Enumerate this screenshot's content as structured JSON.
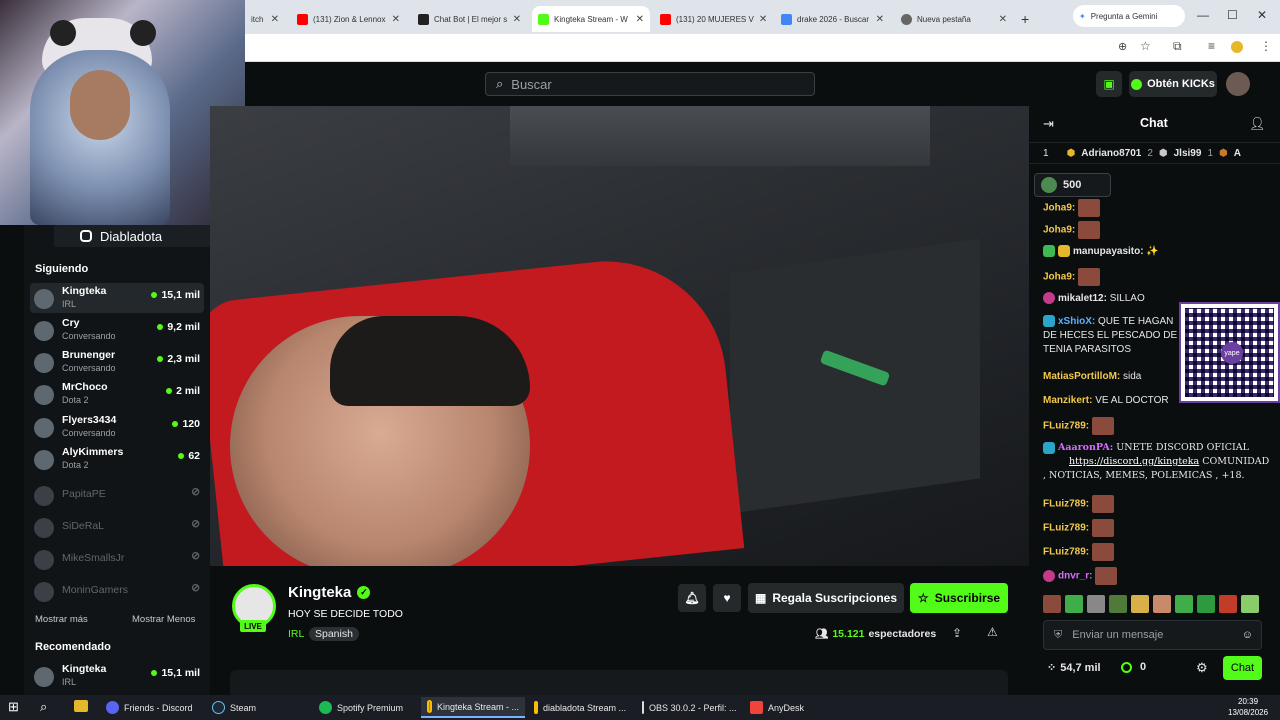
{
  "browser": {
    "tabs": [
      {
        "label": "itch",
        "color": "#9147ff"
      },
      {
        "label": "(131) Zion & Lennox",
        "color": "#ff0000"
      },
      {
        "label": "Chat Bot | El mejor s",
        "color": "#222222"
      },
      {
        "label": "Kingteka Stream - W",
        "color": "#53fc18"
      },
      {
        "label": "(131) 20 MUJERES V",
        "color": "#ff0000"
      },
      {
        "label": "drake 2026 - Buscar",
        "color": "#4285f4"
      },
      {
        "label": "Nueva pestaña",
        "color": "#666666"
      }
    ],
    "gemini_label": "Pregunta a Gemini"
  },
  "webcam": {
    "instagram_handle": "Diabladota"
  },
  "header": {
    "search_placeholder": "Buscar",
    "kicks_label": "Obtén KICKs"
  },
  "sidebar": {
    "following_title": "Siguiendo",
    "following": [
      {
        "name": "Kingteka",
        "category": "IRL",
        "viewers": "15,1 mil",
        "live": true,
        "selected": true
      },
      {
        "name": "Cry",
        "category": "Conversando",
        "viewers": "9,2 mil",
        "live": true
      },
      {
        "name": "Brunenger",
        "category": "Conversando",
        "viewers": "2,3 mil",
        "live": true
      },
      {
        "name": "MrChoco",
        "category": "Dota 2",
        "viewers": "2 mil",
        "live": true
      },
      {
        "name": "Flyers3434",
        "category": "Conversando",
        "viewers": "120",
        "live": true
      },
      {
        "name": "AlyKimmers",
        "category": "Dota 2",
        "viewers": "62",
        "live": true
      },
      {
        "name": "PapitaPE",
        "category": "",
        "viewers": "",
        "live": false
      },
      {
        "name": "SiDeRaL",
        "category": "",
        "viewers": "",
        "live": false
      },
      {
        "name": "MikeSmallsJr",
        "category": "",
        "viewers": "",
        "live": false
      },
      {
        "name": "MoninGamers",
        "category": "",
        "viewers": "",
        "live": false
      }
    ],
    "show_more": "Mostrar más",
    "show_less": "Mostrar Menos",
    "recommended_title": "Recomendado",
    "recommended": [
      {
        "name": "Kingteka",
        "category": "IRL",
        "viewers": "15,1 mil"
      }
    ]
  },
  "stream": {
    "live_badge": "LIVE",
    "channel_name": "Kingteka",
    "title": "HOY SE DECIDE TODO",
    "category": "IRL",
    "language": "Spanish",
    "gift_label": "Regala Suscripciones",
    "subscribe_label": "Suscribirse",
    "viewers_count": "15.121",
    "viewers_label": "espectadores"
  },
  "chat": {
    "title": "Chat",
    "leaderboard": [
      {
        "rank": "1",
        "name": "Adriano8701",
        "count": "2"
      },
      {
        "rank": "",
        "name": "Jlsi99",
        "count": "1"
      },
      {
        "rank": "",
        "name": "A",
        "count": ""
      }
    ],
    "pinned_amount": "500",
    "messages": [
      {
        "user": "Joha9:",
        "text": "",
        "color": "#f2c94c"
      },
      {
        "user": "Joha9:",
        "text": "",
        "color": "#f2c94c"
      },
      {
        "user": "manupayasito:",
        "text": "",
        "color": "#ffffff"
      },
      {
        "user": "Joha9:",
        "text": "",
        "color": "#f2c94c"
      },
      {
        "user": "mikalet12:",
        "text": "SILLAO",
        "color": "#ffffff"
      },
      {
        "user": "xShioX:",
        "text": "QUE TE HAGAN DE HECES EL PESCADO DE TENIA PARASITOS",
        "color": "#5ab0ff"
      },
      {
        "user": "MatiasPortilloM:",
        "text": "sida",
        "color": "#f2c94c"
      },
      {
        "user": "Manzikert:",
        "text": "VE AL DOCTOR",
        "color": "#f2c94c"
      },
      {
        "user": "FLuiz789:",
        "text": "",
        "color": "#f2c94c"
      },
      {
        "user": "AaaronPA:",
        "text": "UNETE DISCORD OFICIAL",
        "color": "#d86bff"
      },
      {
        "user": "FLuiz789:",
        "text": "",
        "color": "#f2c94c"
      },
      {
        "user": "FLuiz789:",
        "text": "",
        "color": "#f2c94c"
      },
      {
        "user": "FLuiz789:",
        "text": "",
        "color": "#f2c94c"
      },
      {
        "user": "dnvr_r:",
        "text": "",
        "color": "#d86bff"
      }
    ],
    "discord_link": "https://discord.gg/kingteka",
    "discord_rest": "COMUNIDAD , NOTICIAS, MEMES, POLEMICAS , +18.",
    "input_placeholder": "Enviar un mensaje",
    "points": "54,7 mil",
    "kicks_balance": "0",
    "send_label": "Chat",
    "qr_label": "yape"
  },
  "taskbar": {
    "items": [
      {
        "label": "Friends - Discord",
        "color": "#5865f2"
      },
      {
        "label": "Steam",
        "color": "#1b2838"
      },
      {
        "label": "Spotify Premium",
        "color": "#1db954"
      },
      {
        "label": "Kingteka Stream - ...",
        "color": "#4285f4",
        "active": true
      },
      {
        "label": "diabladota Stream ...",
        "color": "#4285f4"
      },
      {
        "label": "OBS 30.0.2 - Perfil: ...",
        "color": "#302e31"
      },
      {
        "label": "AnyDesk",
        "color": "#ef443b"
      }
    ],
    "time": "20:39",
    "date": "13/08/2026"
  },
  "colors": {
    "kick_green": "#53fc18",
    "bg": "#0b0e0f"
  }
}
